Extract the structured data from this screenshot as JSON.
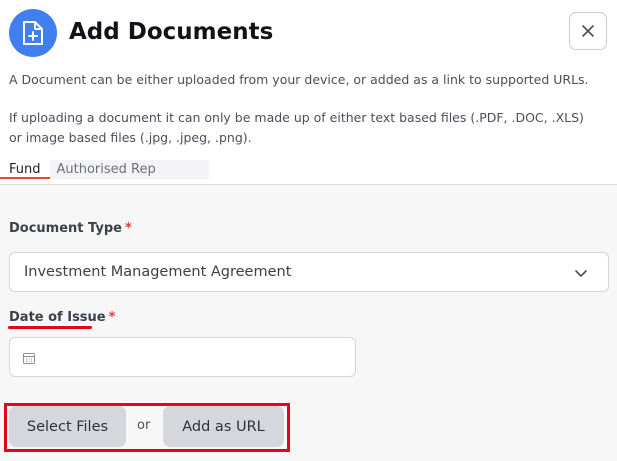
{
  "header": {
    "title": "Add Documents",
    "icon": "file-plus-icon",
    "close_icon": "close-icon"
  },
  "description": {
    "line1": "A Document can be either uploaded from your device, or added as a link to supported URLs.",
    "line2": "If uploading a document it can only be made up of either text based files (.PDF, .DOC, .XLS) or image based files (.jpg, .jpeg, .png)."
  },
  "tabs": [
    {
      "label": "Fund",
      "active": true
    },
    {
      "label": "Authorised Rep",
      "active": false
    }
  ],
  "form": {
    "document_type": {
      "label": "Document Type",
      "required_marker": "*",
      "value": "Investment Management Agreement"
    },
    "date_of_issue": {
      "label": "Date of Issue",
      "required_marker": "*",
      "value": ""
    }
  },
  "actions": {
    "select_files_label": "Select Files",
    "or_label": "or",
    "add_url_label": "Add as URL"
  },
  "colors": {
    "accent_blue": "#3f7ff0",
    "active_tab_underline": "#e9481f",
    "required": "#e23a3a",
    "annotation_red": "#e0081a",
    "button_bg": "#d5d7dc"
  }
}
